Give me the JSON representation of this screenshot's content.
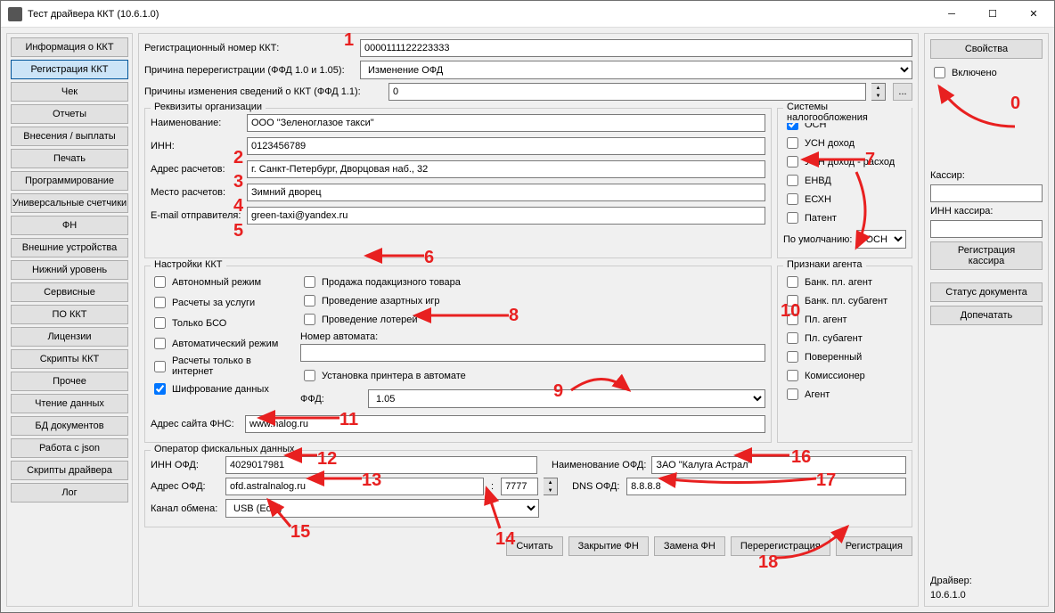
{
  "window": {
    "title": "Тест драйвера ККТ (10.6.1.0)"
  },
  "nav": [
    "Информация о ККТ",
    "Регистрация ККТ",
    "Чек",
    "Отчеты",
    "Внесения / выплаты",
    "Печать",
    "Программирование",
    "Универсальные счетчики",
    "ФН",
    "Внешние устройства",
    "Нижний уровень",
    "Сервисные",
    "ПО ККТ",
    "Лицензии",
    "Скрипты ККТ",
    "Прочее",
    "Чтение данных",
    "БД документов",
    "Работа с json",
    "Скрипты драйвера",
    "Лог"
  ],
  "nav_active": 1,
  "top": {
    "reg_label": "Регистрационный номер ККТ:",
    "reg_value": "0000111122223333",
    "reason_label": "Причина перерегистрации (ФФД 1.0 и 1.05):",
    "reason_value": "Изменение ОФД",
    "changes_label": "Причины изменения сведений о ККТ (ФФД 1.1):",
    "changes_value": "0"
  },
  "org": {
    "legend": "Реквизиты организации",
    "name_label": "Наименование:",
    "name_value": "ООО \"Зеленоглазое такси\"",
    "inn_label": "ИНН:",
    "inn_value": "0123456789",
    "addr_label": "Адрес расчетов:",
    "addr_value": "г. Санкт-Петербург, Дворцовая наб., 32",
    "place_label": "Место расчетов:",
    "place_value": "Зимний дворец",
    "email_label": "E-mail отправителя:",
    "email_value": "green-taxi@yandex.ru"
  },
  "tax": {
    "legend": "Системы налогообложения",
    "items": [
      "ОСН",
      "УСН доход",
      "УСН доход - расход",
      "ЕНВД",
      "ЕСХН",
      "Патент"
    ],
    "checked": [
      true,
      false,
      false,
      false,
      false,
      false
    ],
    "default_label": "По умолчанию:",
    "default_value": "ОСН"
  },
  "kkt": {
    "legend": "Настройки ККТ",
    "col1": [
      "Автономный режим",
      "Расчеты за услуги",
      "Только БСО",
      "Автоматический режим",
      "Расчеты только в интернет",
      "Шифрование данных"
    ],
    "col1_checked": [
      false,
      false,
      false,
      false,
      false,
      true
    ],
    "col2": [
      "Продажа подакцизного товара",
      "Проведение азартных игр",
      "Проведение лотерей"
    ],
    "automat_label": "Номер автомата:",
    "printer_label": "Установка принтера в автомате",
    "ffd_label": "ФФД:",
    "ffd_value": "1.05",
    "fns_label": "Адрес сайта ФНС:",
    "fns_value": "www.nalog.ru"
  },
  "agent": {
    "legend": "Признаки агента",
    "items": [
      "Банк. пл. агент",
      "Банк. пл. субагент",
      "Пл. агент",
      "Пл. субагент",
      "Поверенный",
      "Комиссионер",
      "Агент"
    ]
  },
  "ofd": {
    "legend": "Оператор фискальных данных",
    "inn_label": "ИНН ОФД:",
    "inn_value": "4029017981",
    "addr_label": "Адрес ОФД:",
    "addr_value": "ofd.astralnalog.ru",
    "port_value": "7777",
    "name_label": "Наименование ОФД:",
    "name_value": "ЗАО \"Калуга Астрал\"",
    "dns_label": "DNS ОФД:",
    "dns_value": "8.8.8.8",
    "channel_label": "Канал обмена:",
    "channel_value": "USB (EoU)"
  },
  "bottom_buttons": [
    "Считать",
    "Закрытие ФН",
    "Замена ФН",
    "Перерегистрация",
    "Регистрация"
  ],
  "right": {
    "props": "Свойства",
    "enabled": "Включено",
    "cashier_label": "Кассир:",
    "cashier_inn_label": "ИНН кассира:",
    "reg_cashier": "Регистрация кассира",
    "doc_status": "Статус документа",
    "reprint": "Допечатать",
    "driver_label": "Драйвер:",
    "driver_ver": "10.6.1.0"
  }
}
